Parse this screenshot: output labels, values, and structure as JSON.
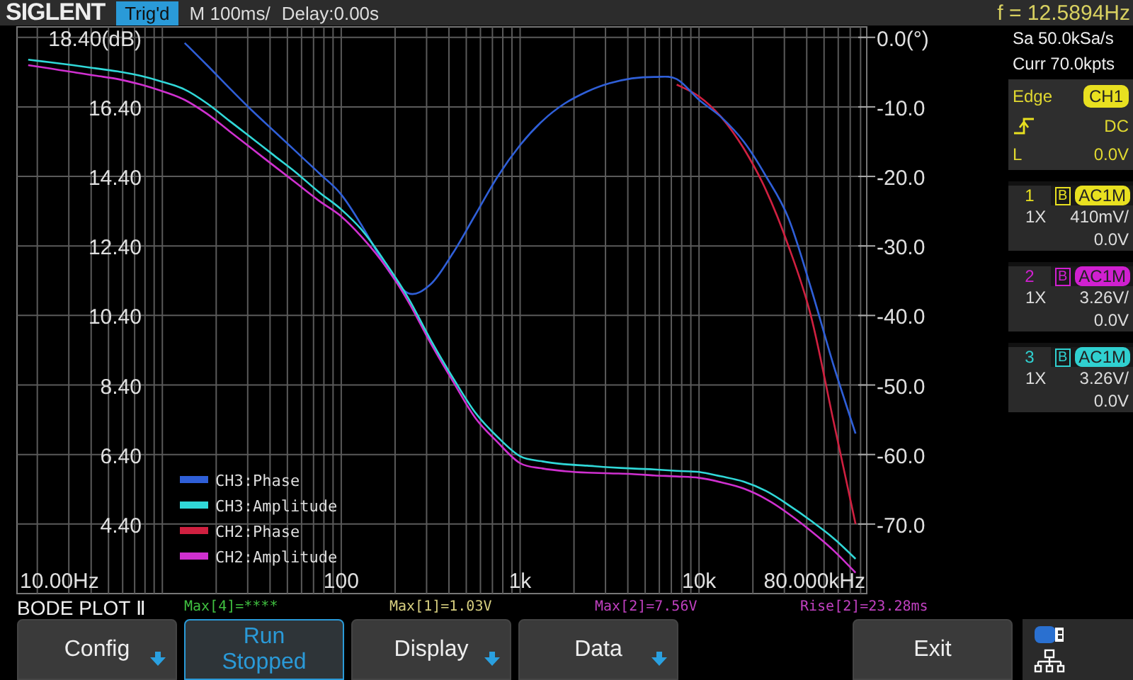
{
  "top_bar": {
    "logo": "SIGLENT",
    "trigger_status": "Trig'd",
    "timebase": "M 100ms/",
    "delay": "Delay:0.00s",
    "frequency": "f = 12.5894Hz"
  },
  "plot": {
    "start_label": "10.00Hz",
    "stop_label": "80.000kHz",
    "chart_data": {
      "type": "line",
      "categories": [
        null,
        null,
        null,
        null,
        null,
        null,
        null,
        null,
        null,
        null,
        null,
        null,
        null,
        null,
        "100",
        null,
        null,
        null,
        null,
        null,
        null,
        null,
        "1k",
        null,
        null,
        null,
        null,
        null,
        null,
        null,
        "10k",
        null,
        null,
        null,
        null,
        null,
        null,
        null
      ],
      "ylim": [
        2.4,
        18.7
      ],
      "y2lim": [
        -80,
        1.5
      ],
      "grid": true,
      "legend": true,
      "yticks": [
        {
          "value": 18.4,
          "label": "18.40(dB)"
        },
        {
          "value": 16.4,
          "label": "16.40"
        },
        {
          "value": 14.4,
          "label": "14.40"
        },
        {
          "value": 12.4,
          "label": "12.40"
        },
        {
          "value": 10.4,
          "label": "10.40"
        },
        {
          "value": 8.4,
          "label": "8.40"
        },
        {
          "value": 6.4,
          "label": "6.40"
        },
        {
          "value": 4.4,
          "label": "4.40"
        }
      ],
      "y2ticks": [
        {
          "value": 0,
          "label": "0.0(°)"
        },
        {
          "value": -10,
          "label": "-10.0"
        },
        {
          "value": -20,
          "label": "-20.0"
        },
        {
          "value": -30,
          "label": "-30.0"
        },
        {
          "value": -40,
          "label": "-40.0"
        },
        {
          "value": -50,
          "label": "-50.0"
        },
        {
          "value": -60,
          "label": "-60.0"
        },
        {
          "value": -70,
          "label": "-70.0"
        }
      ],
      "series": [
        {
          "name": "CH3:Phase",
          "color": "#2f5fd8",
          "axis": "y2",
          "values": [
            null,
            null,
            null,
            null,
            null,
            null,
            null,
            -0.8,
            -4,
            -7.3,
            -10.5,
            -13.5,
            -16.5,
            -19.5,
            -22.6,
            -27.5,
            -33,
            -36.8,
            -35.5,
            -31,
            -25.5,
            -20,
            -15.5,
            -12,
            -9.5,
            -7.8,
            -6.6,
            -5.9,
            -5.7,
            -6,
            -9,
            -11.5,
            -15,
            -20,
            -26,
            -36,
            -47,
            -57
          ]
        },
        {
          "name": "CH3:Amplitude",
          "color": "#30d8d8",
          "values": [
            17.76,
            17.68,
            17.6,
            17.51,
            17.42,
            17.3,
            17.12,
            16.9,
            16.5,
            16.0,
            15.5,
            15.0,
            14.5,
            13.95,
            13.45,
            12.8,
            11.9,
            10.9,
            9.7,
            8.6,
            7.6,
            6.9,
            6.35,
            6.2,
            6.12,
            6.08,
            6.03,
            6.0,
            5.97,
            5.93,
            5.9,
            5.77,
            5.62,
            5.35,
            4.95,
            4.5,
            4.0,
            3.4
          ]
        },
        {
          "name": "CH2:Phase",
          "color": "#d02040",
          "axis": "y2",
          "values": [
            null,
            null,
            null,
            null,
            null,
            null,
            null,
            null,
            null,
            null,
            null,
            null,
            null,
            null,
            null,
            null,
            null,
            null,
            null,
            null,
            null,
            null,
            null,
            null,
            null,
            null,
            null,
            null,
            null,
            -6.8,
            -8.5,
            -11.5,
            -16,
            -22,
            -30,
            -40,
            -55,
            -70
          ]
        },
        {
          "name": "CH2:Amplitude",
          "color": "#d030d0",
          "values": [
            17.6,
            17.5,
            17.4,
            17.3,
            17.2,
            17.05,
            16.85,
            16.6,
            16.2,
            15.7,
            15.2,
            14.7,
            14.2,
            13.7,
            13.25,
            12.6,
            11.8,
            10.8,
            9.6,
            8.5,
            7.45,
            6.75,
            6.15,
            6.0,
            5.92,
            5.88,
            5.86,
            5.84,
            5.8,
            5.77,
            5.73,
            5.6,
            5.42,
            5.12,
            4.7,
            4.2,
            3.65,
            3.0
          ]
        }
      ]
    }
  },
  "mode_label": "BODE PLOT Ⅱ",
  "measurements": [
    {
      "text": "Max[4]=****",
      "color": "#40c040"
    },
    {
      "text": "Max[1]=1.03V",
      "color": "#d8d080"
    },
    {
      "text": "Max[2]=7.56V",
      "color": "#c040c0"
    },
    {
      "text": "Rise[2]=23.28ms",
      "color": "#c040c0"
    }
  ],
  "softkeys": [
    {
      "kind": "menu",
      "label": "Config",
      "selected": false
    },
    {
      "kind": "toggle",
      "label": "Run",
      "value": "Stopped",
      "selected": true
    },
    {
      "kind": "menu",
      "label": "Display",
      "selected": false
    },
    {
      "kind": "menu",
      "label": "Data",
      "selected": false
    },
    {
      "kind": "blank"
    },
    {
      "kind": "plain",
      "label": "Exit",
      "selected": false
    }
  ],
  "side_panel": {
    "sample_rate": "Sa 50.0kSa/s",
    "memory_depth": "Curr 70.0kpts",
    "trigger": {
      "type": "Edge",
      "source": "CH1",
      "coupling": "DC",
      "level_label": "L",
      "level": "0.0V"
    },
    "channels": [
      {
        "number": "1",
        "bandwidth": "B",
        "coupling": "AC1M",
        "probe": "1X",
        "scale": "410mV/",
        "offset": "0.0V",
        "color": "#e8e020"
      },
      {
        "number": "2",
        "bandwidth": "B",
        "coupling": "AC1M",
        "probe": "1X",
        "scale": "3.26V/",
        "offset": "0.0V",
        "color": "#d020d0"
      },
      {
        "number": "3",
        "bandwidth": "B",
        "coupling": "AC1M",
        "probe": "1X",
        "scale": "3.26V/",
        "offset": "0.0V",
        "color": "#30d0d0"
      }
    ]
  }
}
